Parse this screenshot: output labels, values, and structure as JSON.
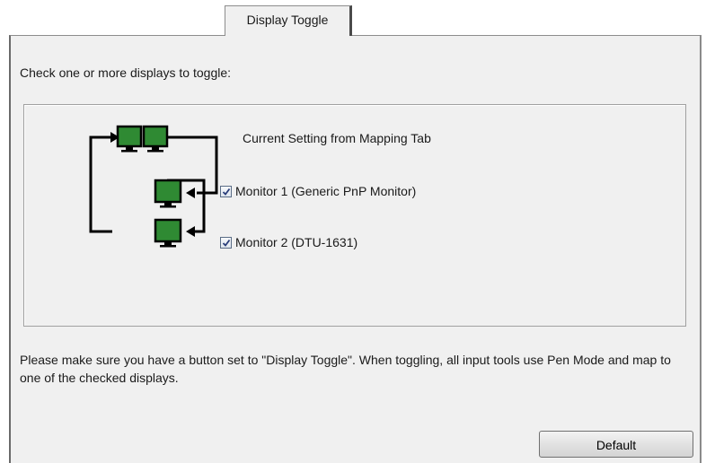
{
  "tabs": [
    {
      "label": "Display Toggle",
      "selected": true
    }
  ],
  "instruction": "Check one or more displays to toggle:",
  "current_setting": "Current Setting from Mapping Tab",
  "monitors": [
    {
      "label": "Monitor 1 (Generic PnP Monitor)",
      "checked": true
    },
    {
      "label": "Monitor 2 (DTU-1631)",
      "checked": true
    }
  ],
  "footer_text": "Please make sure you have a button set to \"Display Toggle\". When toggling, all input tools use Pen Mode and map to one of the checked displays.",
  "default_button": "Default",
  "colors": {
    "monitor_green": "#2f8a33",
    "panel_bg": "#f0f0f0"
  }
}
